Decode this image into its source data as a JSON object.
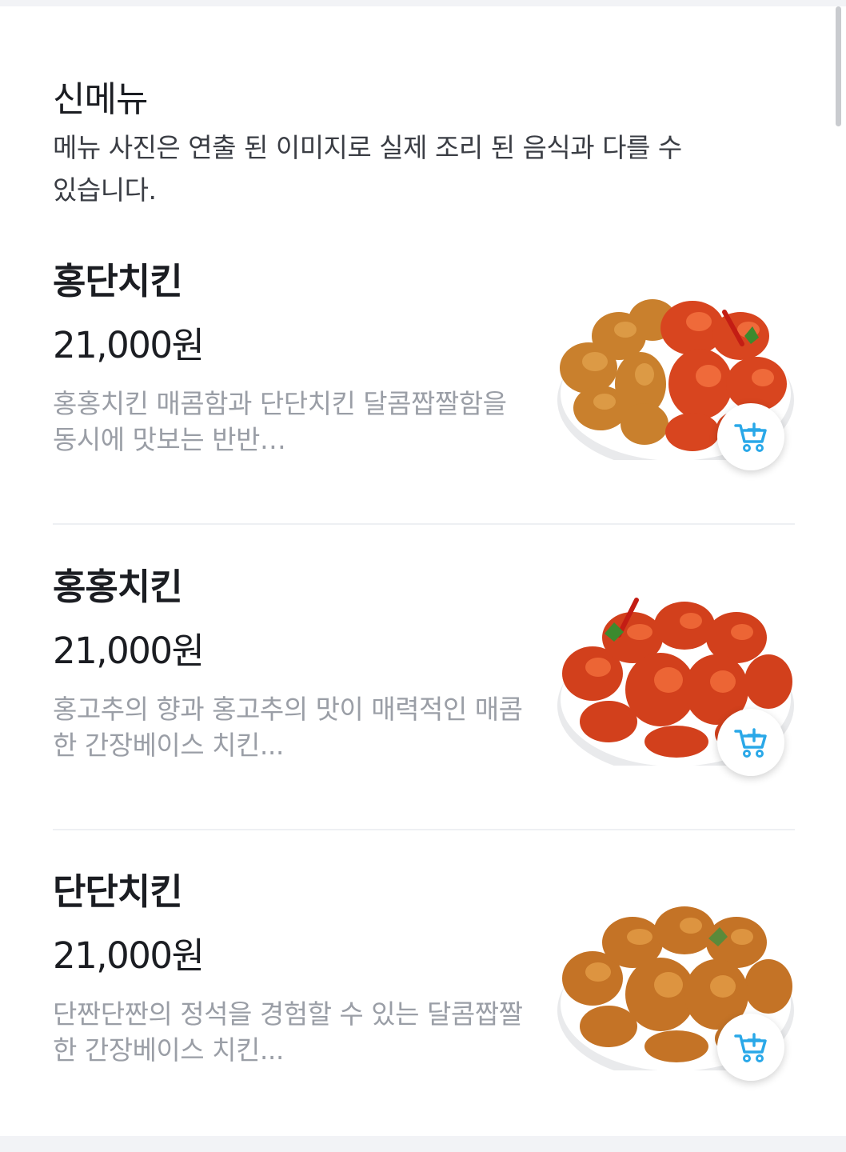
{
  "section": {
    "title": "신메뉴",
    "description": "메뉴 사진은 연출 된 이미지로 실제 조리 된 음식과 다를 수 있습니다."
  },
  "items": [
    {
      "name": "홍단치킨",
      "price": "21,000원",
      "description": "홍홍치킨 매콤함과 단단치킨 달콤짭짤함을 동시에 맛보는 반반…",
      "image_icon": "chicken-half-half-image"
    },
    {
      "name": "홍홍치킨",
      "price": "21,000원",
      "description": "홍고추의 향과 홍고추의 맛이 매력적인 매콤한 간장베이스 치킨...",
      "image_icon": "spicy-chicken-image"
    },
    {
      "name": "단단치킨",
      "price": "21,000원",
      "description": "단짠단짠의 정석을 경험할 수 있는 달콤짭짤한 간장베이스 치킨...",
      "image_icon": "soy-chicken-image"
    }
  ],
  "cart_icon": "add-to-cart-icon",
  "colors": {
    "accent": "#2aa8e8",
    "text_primary": "#1b1d22",
    "text_secondary": "#9a9ea6",
    "divider": "#eef0f3",
    "background": "#f2f3f6"
  }
}
